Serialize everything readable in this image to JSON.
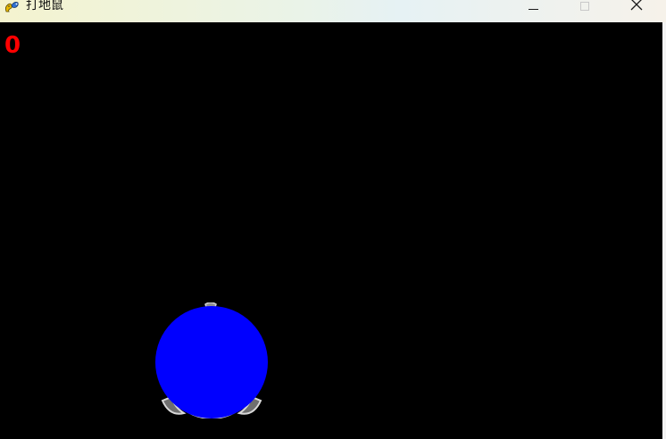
{
  "window": {
    "title": "打地鼠",
    "icon": "pygame-snake-icon",
    "controls": [
      "minimize-icon",
      "maximize-icon",
      "close-icon"
    ]
  },
  "game": {
    "score": "0",
    "colors": {
      "background": "#000000",
      "score": "#ff0000",
      "hammer": "#0000ff",
      "mole": "#9a9a9a"
    }
  }
}
